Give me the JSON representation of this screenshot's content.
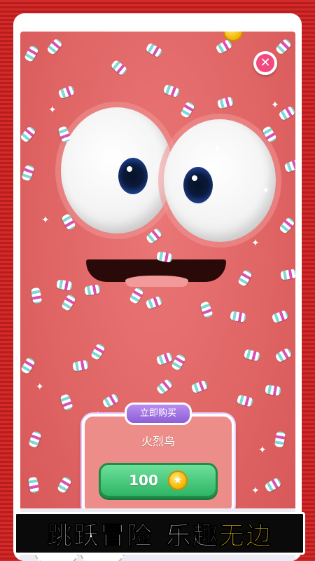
{
  "product": {
    "tab_label": "立即购买",
    "name": "火烈鸟",
    "price": "100",
    "coin_icon": "star-coin-icon"
  },
  "close_icon": "close-icon",
  "banner": {
    "part1": "跳跃冒险",
    "part2": "乐趣",
    "part3": "无边"
  },
  "colors": {
    "background_stripes": "#d42a2a",
    "face": "#e06565",
    "buy_button": "#2fb565",
    "tab": "#8c5fd6",
    "close": "#f2497e",
    "banner_highlight": "#ffd21a"
  }
}
